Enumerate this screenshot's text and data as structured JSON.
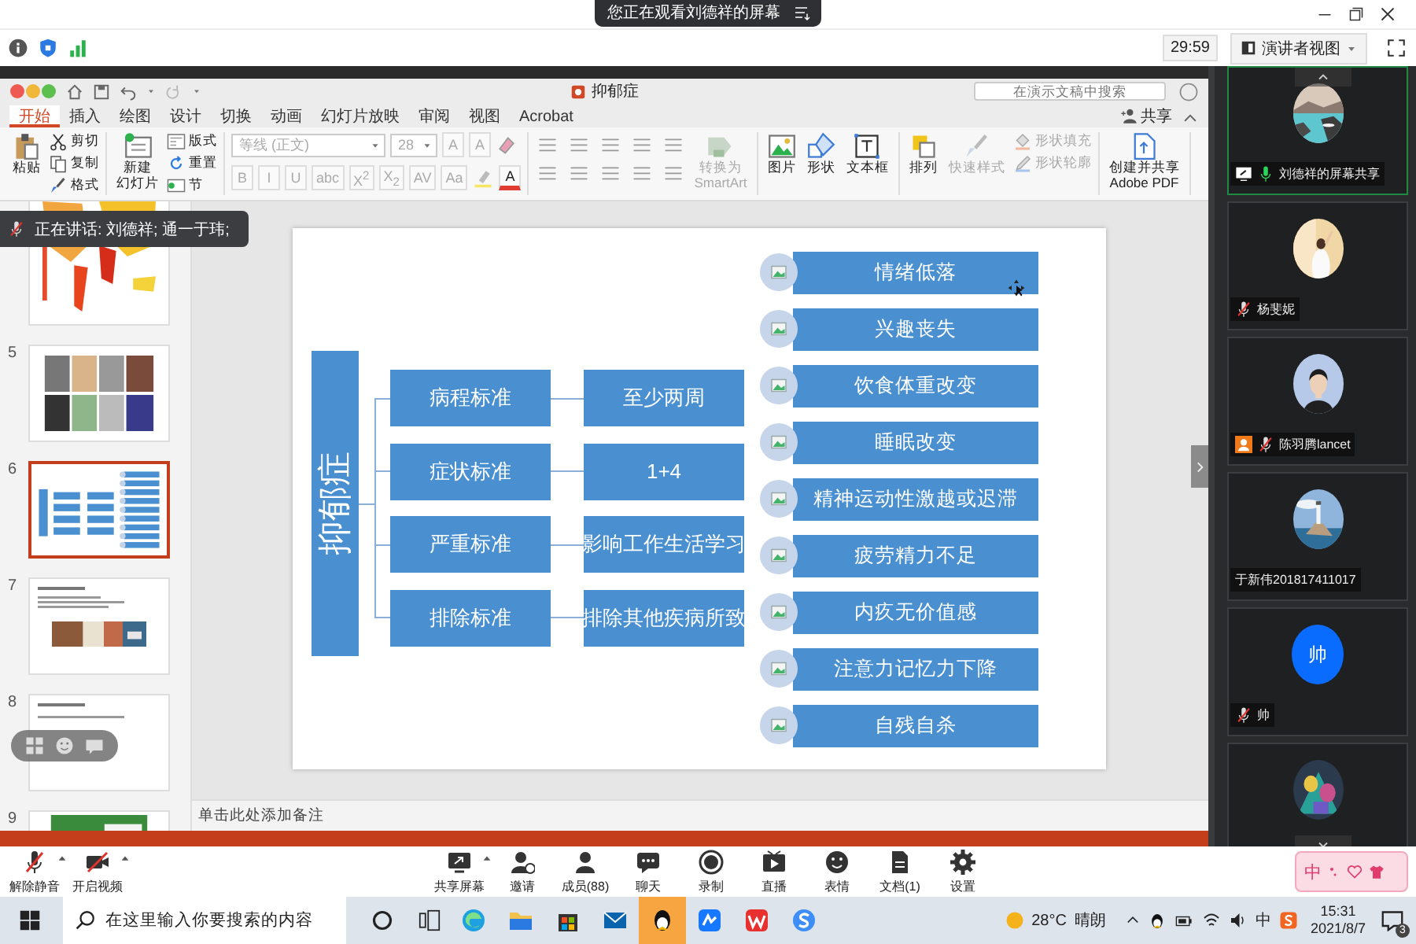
{
  "viewer_banner": {
    "text": "您正在观看刘德祥的屏幕"
  },
  "meeting_bar": {
    "timer": "29:59",
    "view_button": "演讲者视图"
  },
  "ppt": {
    "title": "抑郁症",
    "search_placeholder": "在演示文稿中搜索",
    "tabs": [
      {
        "label": "开始",
        "selected": true
      },
      {
        "label": "插入",
        "selected": false
      },
      {
        "label": "绘图",
        "selected": false
      },
      {
        "label": "设计",
        "selected": false
      },
      {
        "label": "切换",
        "selected": false
      },
      {
        "label": "动画",
        "selected": false
      },
      {
        "label": "幻灯片放映",
        "selected": false
      },
      {
        "label": "审阅",
        "selected": false
      },
      {
        "label": "视图",
        "selected": false
      },
      {
        "label": "Acrobat",
        "selected": false
      }
    ],
    "share": "共享",
    "ribbon": [
      {
        "kind": "items",
        "items": [
          {
            "kind": "large",
            "label": "粘贴",
            "disabled": false
          },
          {
            "kind": "small",
            "label": "剪切",
            "disabled": false
          },
          {
            "kind": "small",
            "label": "复制",
            "disabled": false
          },
          {
            "kind": "small",
            "label": "格式",
            "disabled": false
          }
        ]
      },
      {
        "kind": "items",
        "items": [
          {
            "kind": "large",
            "lines": [
              "新建",
              "幻灯片"
            ],
            "disabled": false
          },
          {
            "kind": "small",
            "label": "版式",
            "disabled": false
          },
          {
            "kind": "small",
            "label": "重置",
            "disabled": false
          },
          {
            "kind": "small",
            "label": "节",
            "disabled": false
          }
        ]
      },
      {
        "kind": "font",
        "upper": [
          {
            "kind": "field",
            "label": "等线 (正文)",
            "disabled": true
          },
          {
            "kind": "size",
            "label": "28",
            "disabled": true
          },
          {
            "kind": "format",
            "label": "A",
            "disabled": true
          },
          {
            "kind": "format",
            "label": "A",
            "disabled": true
          }
        ],
        "lower": [
          {
            "kind": "format",
            "label": "B",
            "disabled": true
          },
          {
            "kind": "format",
            "label": "I",
            "disabled": true
          },
          {
            "kind": "format",
            "label": "U",
            "disabled": true
          },
          {
            "kind": "format",
            "label": "abc",
            "disabled": true
          },
          {
            "kind": "format",
            "label": "X$^{2}$",
            "disabled": true
          },
          {
            "kind": "format",
            "label": "X$_{2}$",
            "disabled": true
          },
          {
            "kind": "format",
            "label": "AV",
            "disabled": true
          },
          {
            "kind": "format",
            "label": "Aa",
            "disabled": true
          },
          {
            "kind": "color",
            "label": "A",
            "disabled": false
          }
        ]
      },
      {
        "kind": "paragraph",
        "items": [
          {
            "kind": "large",
            "label": "转换为\nSmartArt",
            "disabled": true
          }
        ]
      },
      {
        "kind": "items",
        "items": [
          {
            "kind": "large",
            "label": "图片",
            "disabled": false
          },
          {
            "kind": "large",
            "label": "形状",
            "disabled": false
          },
          {
            "kind": "large",
            "label": "文本框",
            "disabled": false
          }
        ]
      },
      {
        "kind": "items",
        "items": [
          {
            "kind": "large",
            "label": "排列",
            "disabled": false
          },
          {
            "kind": "large",
            "label": "快速样式",
            "disabled": true
          },
          {
            "kind": "small",
            "label": "形状填充",
            "disabled": true
          },
          {
            "kind": "small",
            "label": "形状轮廓",
            "disabled": true
          }
        ]
      },
      {
        "kind": "items",
        "items": [
          {
            "kind": "large",
            "label": "创建并共享\nAdobe PDF",
            "disabled": false
          }
        ]
      }
    ],
    "thumbnails": [
      {
        "kind": "map",
        "selected": false
      },
      {
        "number": "5",
        "kind": "photos",
        "selected": false
      },
      {
        "number": "6",
        "kind": "diagram",
        "selected": true
      },
      {
        "number": "7",
        "kind": "text_photos",
        "selected": false
      },
      {
        "number": "8",
        "kind": "text",
        "selected": false
      },
      {
        "number": "9",
        "selected": false
      }
    ],
    "speaking_tooltip": "正在讲话: 刘德祥; 通一于玮;",
    "notes_placeholder": "单击此处添加备注",
    "slide": {
      "title": "抑郁症",
      "criteria": [
        {
          "label": "病程标准",
          "value": "至少两周"
        },
        {
          "label": "症状标准",
          "value": "1+4"
        },
        {
          "label": "严重标准",
          "value": "影响工作生活学习"
        },
        {
          "label": "排除标准",
          "value": "排除其他疾病所致"
        }
      ],
      "symptoms": [
        "情绪低落",
        "兴趣丧失",
        "饮食体重改变",
        "睡眠改变",
        "精神运动性激越或迟滞",
        "疲劳精力不足",
        "内疚无价值感",
        "注意力记忆力下降",
        "自残自杀"
      ]
    }
  },
  "participants": [
    {
      "name": "刘德祥的屏幕共享",
      "mic_icon": true,
      "muted": false,
      "sharing": true,
      "badge": false,
      "speaking": true
    },
    {
      "name": "杨斐妮",
      "mic_icon": true,
      "muted": true,
      "sharing": false,
      "badge": false,
      "speaking": false
    },
    {
      "name": "陈羽腾lancet",
      "mic_icon": true,
      "muted": true,
      "sharing": false,
      "badge": true,
      "speaking": false
    },
    {
      "name": "于新伟201817411017",
      "mic_icon": false,
      "sharing": false,
      "badge": false,
      "speaking": false
    },
    {
      "name": "帅",
      "avatar": {
        "kind": "letter",
        "text": "帅"
      },
      "mic_icon": true,
      "muted": true,
      "sharing": false,
      "badge": false,
      "speaking": false
    },
    {
      "mic_icon": false,
      "sharing": false,
      "badge": false,
      "speaking": false
    }
  ],
  "toolbar": [
    {
      "label": "解除静音",
      "caret": true
    },
    {
      "label": "开启视频",
      "caret": true
    },
    {
      "label": "共享屏幕",
      "caret": true
    },
    {
      "label": "邀请",
      "caret": false
    },
    {
      "label": "成员(88)",
      "caret": false
    },
    {
      "label": "聊天",
      "caret": false
    },
    {
      "label": "录制",
      "caret": false
    },
    {
      "label": "直播",
      "caret": false
    },
    {
      "label": "表情",
      "caret": false
    },
    {
      "label": "文档(1)",
      "caret": false
    },
    {
      "label": "设置",
      "caret": false
    }
  ],
  "ime": {
    "mode": "中"
  },
  "taskbar": {
    "search_placeholder": "在这里输入你要搜索的内容",
    "apps": [
      {
        "selected": false
      },
      {
        "selected": false
      },
      {
        "selected": false
      },
      {
        "selected": false
      },
      {
        "selected": true
      },
      {
        "selected": false
      },
      {
        "selected": false
      },
      {
        "selected": false
      }
    ],
    "temperature": "28°C",
    "weather": "晴朗",
    "input_mode": "中",
    "time": "15:31",
    "date": "2021/8/7",
    "notifications": "3"
  }
}
